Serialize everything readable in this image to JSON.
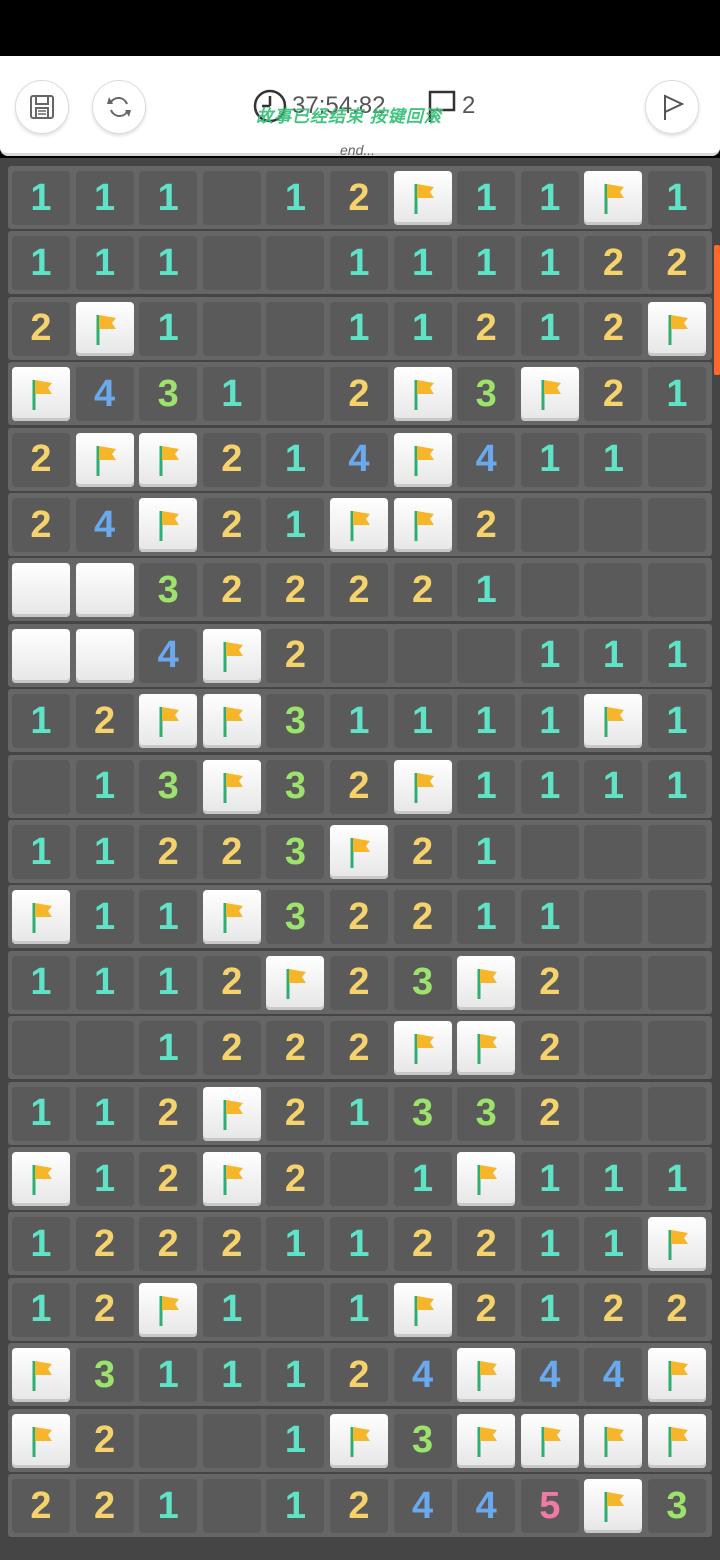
{
  "toolbar": {
    "timer": "37:54:82",
    "flag_count": "2",
    "message": "故事已经结束 按键回滚",
    "end_text": "end..."
  },
  "colors": {
    "n1": "#5ee3c6",
    "n2": "#f5d26b",
    "n3": "#9be36a",
    "n4": "#6aa9ee",
    "n5": "#f07aa7",
    "flag": "#f7b52a",
    "board": "#454545"
  },
  "board": [
    [
      "1",
      "1",
      "1",
      "",
      "1",
      "2",
      "F",
      "1",
      "1",
      "F",
      "1"
    ],
    [
      "1",
      "1",
      "1",
      "",
      "",
      "1",
      "1",
      "1",
      "1",
      "2",
      "2"
    ],
    [
      "2",
      "F",
      "1",
      "",
      "",
      "1",
      "1",
      "2",
      "1",
      "2",
      "F"
    ],
    [
      "F",
      "4",
      "3",
      "1",
      "",
      "2",
      "F",
      "3",
      "F",
      "2",
      "1"
    ],
    [
      "2",
      "F",
      "F",
      "2",
      "1",
      "4",
      "F",
      "4",
      "1",
      "1",
      ""
    ],
    [
      "2",
      "4",
      "F",
      "2",
      "1",
      "F",
      "F",
      "2",
      "",
      "",
      ""
    ],
    [
      "C",
      "C",
      "3",
      "2",
      "2",
      "2",
      "2",
      "1",
      "",
      "",
      ""
    ],
    [
      "C",
      "C",
      "4",
      "F",
      "2",
      "",
      "",
      "",
      "1",
      "1",
      "1"
    ],
    [
      "1",
      "2",
      "F",
      "F",
      "3",
      "1",
      "1",
      "1",
      "1",
      "F",
      "1"
    ],
    [
      "",
      "1",
      "3",
      "F",
      "3",
      "2",
      "F",
      "1",
      "1",
      "1",
      "1"
    ],
    [
      "1",
      "1",
      "2",
      "2",
      "3",
      "F",
      "2",
      "1",
      "",
      "",
      ""
    ],
    [
      "F",
      "1",
      "1",
      "F",
      "3",
      "2",
      "2",
      "1",
      "1",
      "",
      ""
    ],
    [
      "1",
      "1",
      "1",
      "2",
      "F",
      "2",
      "3",
      "F",
      "2",
      "",
      ""
    ],
    [
      "",
      "",
      "1",
      "2",
      "2",
      "2",
      "F",
      "F",
      "2",
      "",
      ""
    ],
    [
      "1",
      "1",
      "2",
      "F",
      "2",
      "1",
      "3",
      "3",
      "2",
      "",
      ""
    ],
    [
      "F",
      "1",
      "2",
      "F",
      "2",
      "",
      "1",
      "F",
      "1",
      "1",
      "1"
    ],
    [
      "1",
      "2",
      "2",
      "2",
      "1",
      "1",
      "2",
      "2",
      "1",
      "1",
      "F"
    ],
    [
      "1",
      "2",
      "F",
      "1",
      "",
      "1",
      "F",
      "2",
      "1",
      "2",
      "2"
    ],
    [
      "F",
      "3",
      "1",
      "1",
      "1",
      "2",
      "4",
      "F",
      "4",
      "4",
      "F"
    ],
    [
      "F",
      "2",
      "",
      "",
      "1",
      "F",
      "3",
      "F",
      "F",
      "F",
      "F"
    ],
    [
      "2",
      "2",
      "1",
      "",
      "1",
      "2",
      "4",
      "4",
      "5",
      "F",
      "3"
    ]
  ]
}
